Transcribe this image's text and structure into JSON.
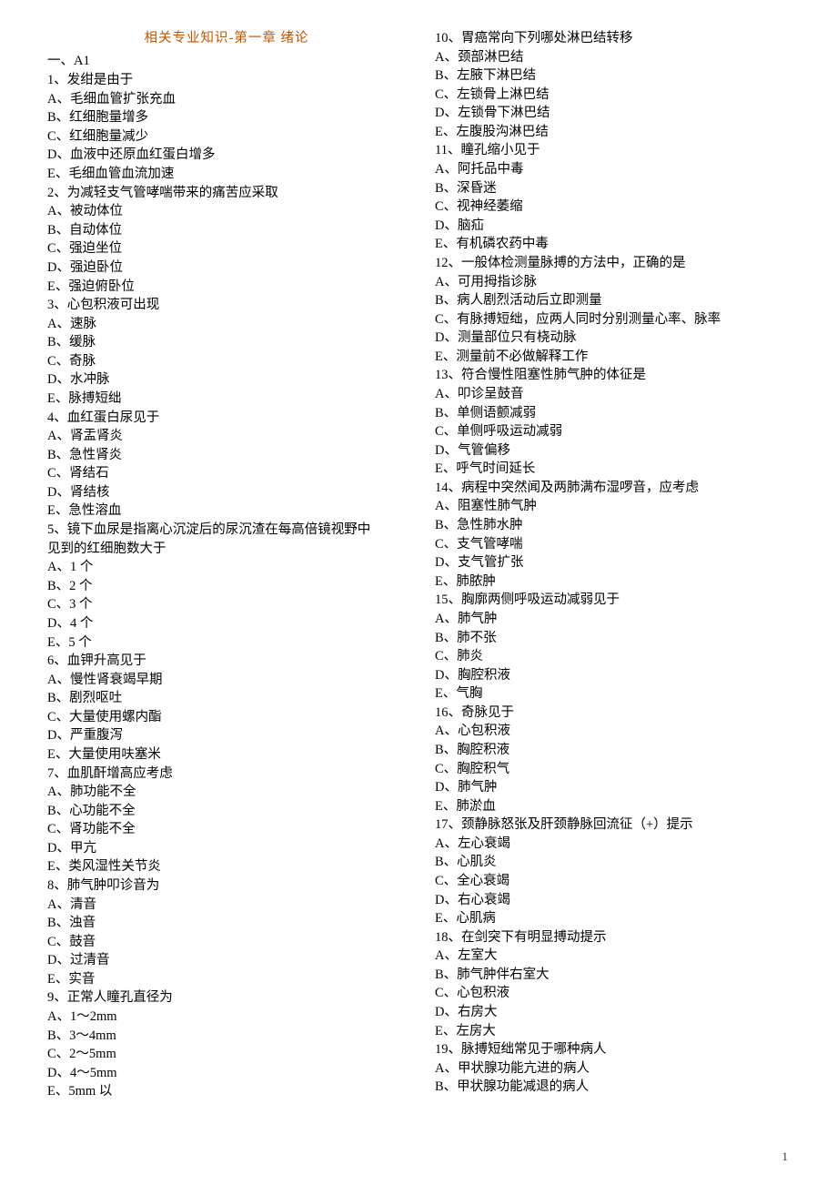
{
  "title": "相关专业知识-第一章 绪论",
  "sectionHead": "一、A1",
  "pageNum": "1",
  "col1": [
    "1、发绀是由于",
    "A、毛细血管扩张充血",
    "B、红细胞量增多",
    "C、红细胞量减少",
    "D、血液中还原血红蛋白增多",
    "E、毛细血管血流加速",
    "2、为减轻支气管哮喘带来的痛苦应采取",
    "A、被动体位",
    "B、自动体位",
    "C、强迫坐位",
    "D、强迫卧位",
    "E、强迫俯卧位",
    "3、心包积液可出现",
    "A、速脉",
    "B、缓脉",
    "C、奇脉",
    "D、水冲脉",
    "E、脉搏短绌",
    "4、血红蛋白尿见于",
    "A、肾盂肾炎",
    "B、急性肾炎",
    "C、肾结石",
    "D、肾结核",
    "E、急性溶血",
    "5、镜下血尿是指离心沉淀后的尿沉渣在每高倍镜视野中",
    "见到的红细胞数大于",
    "A、1 个",
    "B、2 个",
    "C、3 个",
    "D、4 个",
    "E、5 个",
    "6、血钾升高见于",
    "A、慢性肾衰竭早期",
    "B、剧烈呕吐",
    "C、大量使用螺内酯",
    "D、严重腹泻",
    "E、大量使用呋塞米",
    "7、血肌酐增高应考虑",
    "A、肺功能不全",
    "B、心功能不全",
    "C、肾功能不全",
    "D、甲亢",
    "E、类风湿性关节炎",
    "8、肺气肿叩诊音为",
    "A、清音",
    "B、浊音",
    "C、鼓音",
    "D、过清音",
    "E、实音",
    "9、正常人瞳孔直径为",
    "A、1～2mm",
    "B、3～4mm",
    "C、2～5mm",
    "D、4～5mm",
    "E、5mm 以"
  ],
  "col2": [
    "10、胃癌常向下列哪处淋巴结转移",
    "A、颈部淋巴结",
    "B、左腋下淋巴结",
    "C、左锁骨上淋巴结",
    "D、左锁骨下淋巴结",
    "E、左腹股沟淋巴结",
    "11、瞳孔缩小见于",
    "A、阿托品中毒",
    "B、深昏迷",
    "C、视神经萎缩",
    "D、脑疝",
    "E、有机磷农药中毒",
    "12、一般体检测量脉搏的方法中，正确的是",
    "A、可用拇指诊脉",
    "B、病人剧烈活动后立即测量",
    "C、有脉搏短绌，应两人同时分别测量心率、脉率",
    "D、测量部位只有桡动脉",
    "E、测量前不必做解释工作",
    "13、符合慢性阻塞性肺气肿的体征是",
    "A、叩诊呈鼓音",
    "B、单侧语颤减弱",
    "C、单侧呼吸运动减弱",
    "D、气管偏移",
    "E、呼气时间延长",
    "14、病程中突然闻及两肺满布湿啰音，应考虑",
    "A、阻塞性肺气肿",
    "B、急性肺水肿",
    "C、支气管哮喘",
    "D、支气管扩张",
    "E、肺脓肿",
    "15、胸廓两侧呼吸运动减弱见于",
    "A、肺气肿",
    "B、肺不张",
    "C、肺炎",
    "D、胸腔积液",
    "E、气胸",
    "16、奇脉见于",
    "A、心包积液",
    "B、胸腔积液",
    "C、胸腔积气",
    "D、肺气肿",
    "E、肺淤血",
    "17、颈静脉怒张及肝颈静脉回流征（+）提示",
    "A、左心衰竭",
    "B、心肌炎",
    "C、全心衰竭",
    "D、右心衰竭",
    "E、心肌病",
    "18、在剑突下有明显搏动提示",
    "A、左室大",
    "B、肺气肿伴右室大",
    "C、心包积液",
    "D、右房大",
    "E、左房大",
    "19、脉搏短绌常见于哪种病人",
    "A、甲状腺功能亢进的病人",
    "B、甲状腺功能减退的病人"
  ]
}
